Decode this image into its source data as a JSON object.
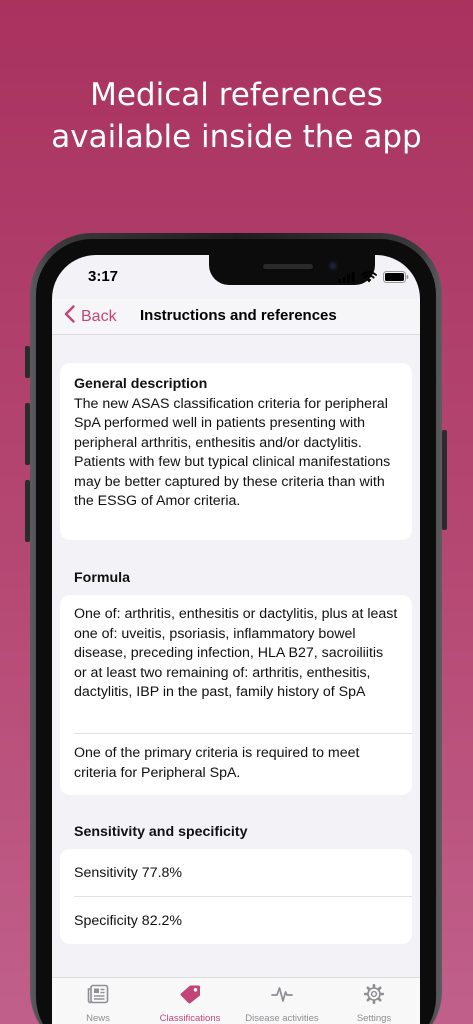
{
  "promo": {
    "line1": "Medical references",
    "line2": "available inside the app"
  },
  "status_bar": {
    "time": "3:17"
  },
  "nav": {
    "back_label": "Back",
    "title": "Instructions and references"
  },
  "general": {
    "title": "General description",
    "text": "The new ASAS classification criteria for peripheral SpA performed well in patients presenting with peripheral arthritis, enthesitis and/or dactylitis. Patients with few but typical clinical manifestations may be better captured by these criteria than with the ESSG of Amor criteria."
  },
  "formula": {
    "header": "Formula",
    "items": [
      "One of: arthritis, enthesitis or dactylitis, plus at least one of: uveitis, psoriasis, inflammatory bowel disease, preceding infection, HLA B27, sacroiliitis or at least two remaining of: arthritis, enthesitis, dactylitis, IBP in the past, family history of SpA",
      "One of the primary criteria is required to meet criteria for Peripheral SpA."
    ]
  },
  "sensitivity": {
    "header": "Sensitivity and specificity",
    "items": [
      "Sensitivity 77.8%",
      "Specificity 82.2%"
    ]
  },
  "tabs": [
    {
      "label": "News",
      "icon": "newspaper-icon",
      "active": false
    },
    {
      "label": "Classifications",
      "icon": "tag-icon",
      "active": true
    },
    {
      "label": "Disease activities",
      "icon": "pulse-icon",
      "active": false
    },
    {
      "label": "Settings",
      "icon": "gear-icon",
      "active": false
    }
  ],
  "colors": {
    "background": "#ad3a67",
    "accent": "#c2457a",
    "inactive": "#8e8e93"
  }
}
